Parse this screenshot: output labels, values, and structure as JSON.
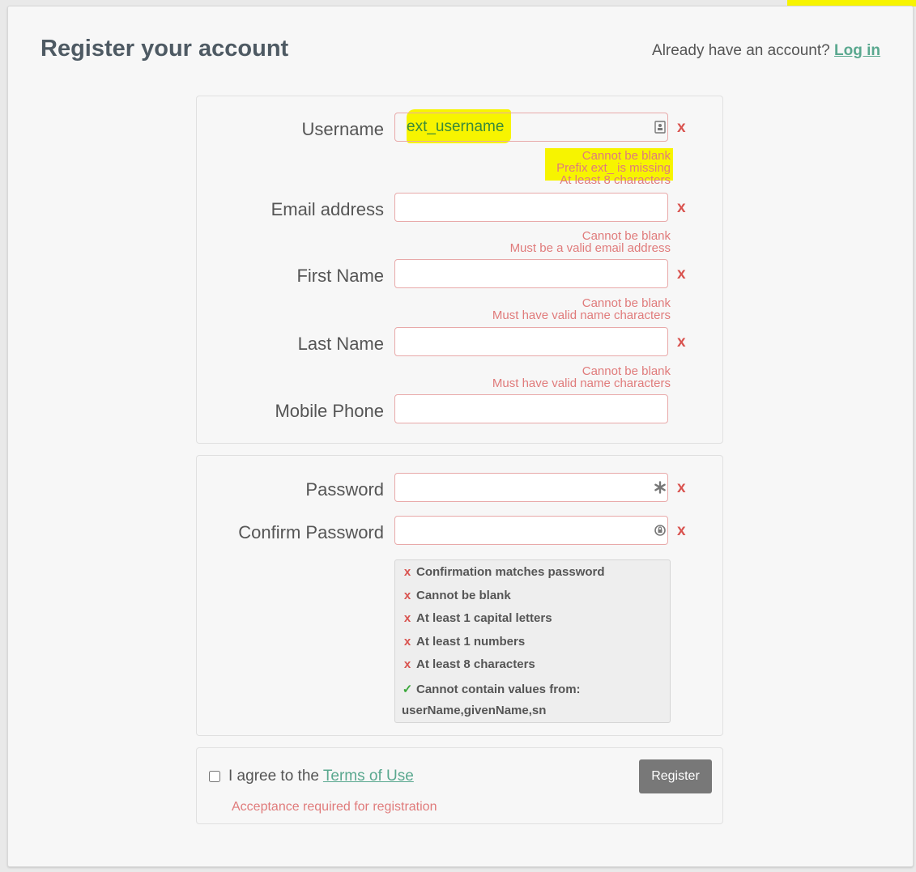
{
  "header": {
    "title": "Register your account",
    "login_prompt": "Already have an account?",
    "login_link": "Log in"
  },
  "profile": {
    "username": {
      "label": "Username",
      "value": "ext_username",
      "icon": "contact-card-icon",
      "errors": [
        "Cannot be blank",
        "Prefix ext_ is missing",
        "At least 8 characters"
      ]
    },
    "email": {
      "label": "Email address",
      "value": "",
      "errors": [
        "Cannot be blank",
        "Must be a valid email address"
      ]
    },
    "first_name": {
      "label": "First Name",
      "value": "",
      "errors": [
        "Cannot be blank",
        "Must have valid name characters"
      ]
    },
    "last_name": {
      "label": "Last Name",
      "value": "",
      "errors": [
        "Cannot be blank",
        "Must have valid name characters"
      ]
    },
    "mobile_phone": {
      "label": "Mobile Phone",
      "value": ""
    }
  },
  "security": {
    "password": {
      "label": "Password",
      "value": "",
      "icon": "asterisk-icon"
    },
    "confirm_password": {
      "label": "Confirm Password",
      "value": "",
      "icon": "lock-refresh-icon"
    },
    "rules": [
      {
        "text": "Confirmation matches password",
        "status": "fail"
      },
      {
        "text": "Cannot be blank",
        "status": "fail"
      },
      {
        "text": "At least 1 capital letters",
        "status": "fail"
      },
      {
        "text": "At least 1 numbers",
        "status": "fail"
      },
      {
        "text": "At least 8 characters",
        "status": "fail"
      },
      {
        "text": "Cannot contain values from:",
        "text2": "userName,givenName,sn",
        "status": "pass"
      }
    ]
  },
  "error_mark": "x",
  "pass_mark": "✓",
  "terms": {
    "prefix": "I agree to the",
    "link": "Terms of Use",
    "error": "Acceptance required for registration",
    "checked": false
  },
  "actions": {
    "register_label": "Register"
  },
  "colors": {
    "error": "#d9534f",
    "link": "#5aa88f",
    "highlight": "#f7f400",
    "button": "#787878"
  }
}
